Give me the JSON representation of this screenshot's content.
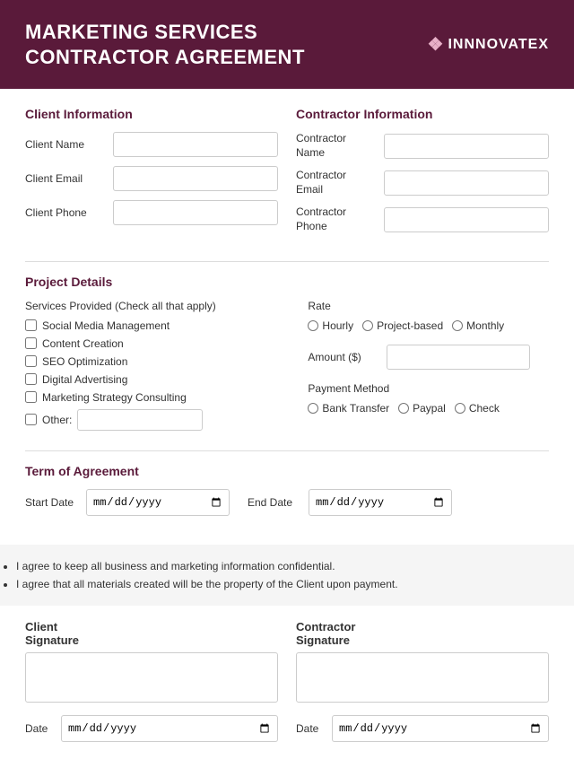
{
  "header": {
    "title_line1": "MARKETING SERVICES",
    "title_line2": "CONTRACTOR AGREEMENT",
    "logo_hash": "❖",
    "logo_text": "INNNOVATEX"
  },
  "client_info": {
    "section_title": "Client Information",
    "fields": [
      {
        "label": "Client Name",
        "name": "client-name"
      },
      {
        "label": "Client Email",
        "name": "client-email"
      },
      {
        "label": "Client Phone",
        "name": "client-phone"
      }
    ]
  },
  "contractor_info": {
    "section_title": "Contractor Information",
    "fields": [
      {
        "label_line1": "Contractor",
        "label_line2": "Name",
        "name": "contractor-name"
      },
      {
        "label_line1": "Contractor",
        "label_line2": "Email",
        "name": "contractor-email"
      },
      {
        "label_line1": "Contractor",
        "label_line2": "Phone",
        "name": "contractor-phone"
      }
    ]
  },
  "project_details": {
    "section_title": "Project Details",
    "services_label": "Services Provided (Check all that apply)",
    "services": [
      "Social Media Management",
      "Content Creation",
      "SEO Optimization",
      "Digital Advertising",
      "Marketing Strategy Consulting"
    ],
    "other_label": "Other:",
    "rate": {
      "label": "Rate",
      "options": [
        "Hourly",
        "Project-based",
        "Monthly"
      ]
    },
    "amount": {
      "label": "Amount ($)"
    },
    "payment": {
      "label": "Payment Method",
      "options": [
        "Bank Transfer",
        "Paypal",
        "Check"
      ]
    }
  },
  "term": {
    "section_title": "Term of Agreement",
    "start_label": "Start Date",
    "end_label": "End Date",
    "date_placeholder": "mm/dd/yyyy"
  },
  "agreement": {
    "bullets": [
      "I agree to keep all business and marketing information confidential.",
      "I agree that all materials created will be the property of the Client upon payment."
    ]
  },
  "signatures": {
    "client_sig_label": "Client\nSignature",
    "contractor_sig_label": "Contractor\nSignature",
    "date_label": "Date",
    "date_placeholder": "mm/dd/yyyy"
  }
}
